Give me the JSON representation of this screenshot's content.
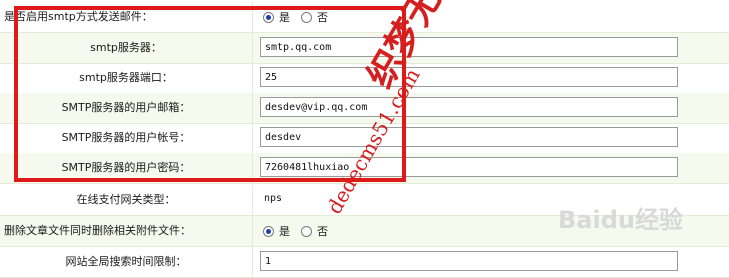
{
  "rows": [
    {
      "type": "radio",
      "label": "是否启用smtp方式发送邮件：",
      "options": [
        "是",
        "否"
      ],
      "selected": 0
    },
    {
      "type": "input",
      "label": "smtp服务器：",
      "value": "smtp.qq.com"
    },
    {
      "type": "input",
      "label": "smtp服务器端口：",
      "value": "25"
    },
    {
      "type": "input",
      "label": "SMTP服务器的用户邮箱：",
      "value": "desdev@vip.qq.com"
    },
    {
      "type": "input",
      "label": "SMTP服务器的用户帐号：",
      "value": "desdev"
    },
    {
      "type": "input",
      "label": "SMTP服务器的用户密码：",
      "value": "7260481lhuxiao"
    },
    {
      "type": "input",
      "label": "在线支付网关类型：",
      "value": "nps"
    },
    {
      "type": "radio",
      "label": "删除文章文件同时删除相关附件文件：",
      "options": [
        "是",
        "否"
      ],
      "selected": 0
    },
    {
      "type": "input",
      "label": "网站全局搜索时间限制：",
      "value": "1"
    }
  ],
  "watermark": {
    "text1": "织梦无忧",
    "text2": "dedecms51.com",
    "baidu": "Baidu经验"
  },
  "colors": {
    "highlight": "#e01a1a",
    "row_alt": "#f6f9ee",
    "border": "#e4ecd6"
  }
}
